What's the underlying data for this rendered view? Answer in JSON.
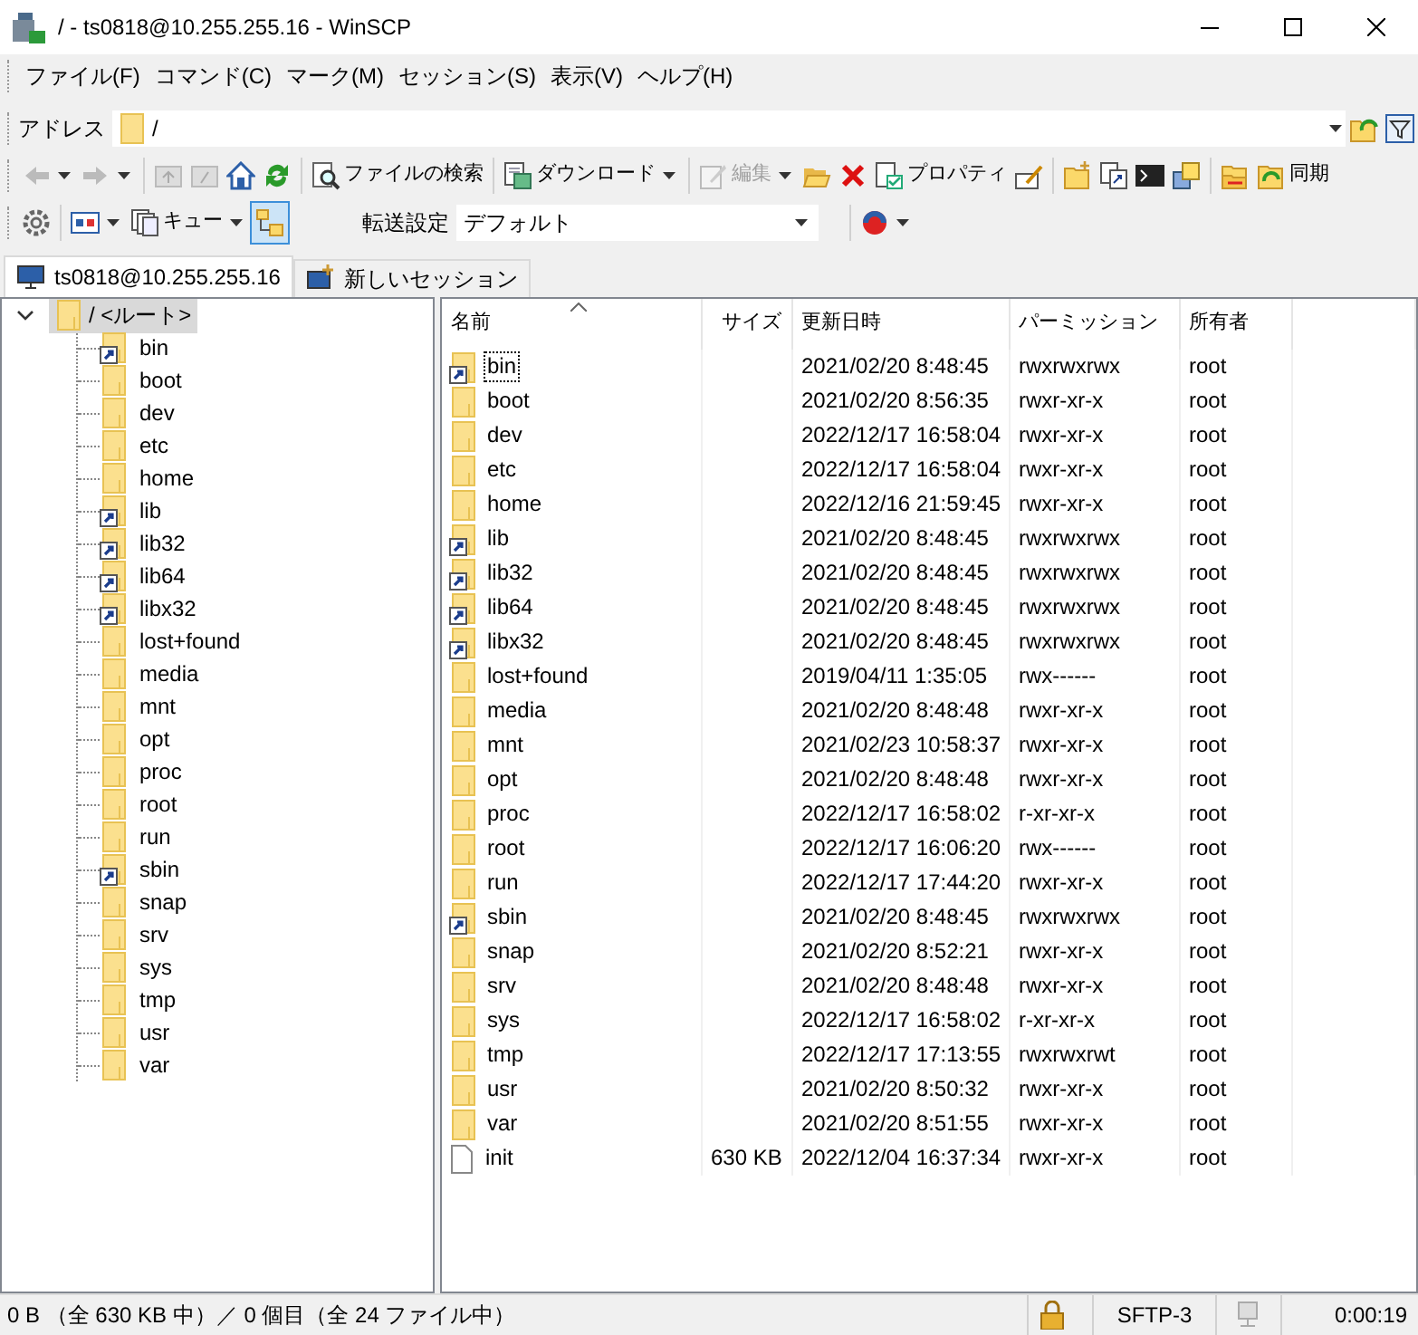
{
  "window": {
    "title": "/ - ts0818@10.255.255.16 - WinSCP"
  },
  "menu": [
    "ファイル(F)",
    "コマンド(C)",
    "マーク(M)",
    "セッション(S)",
    "表示(V)",
    "ヘルプ(H)"
  ],
  "address": {
    "label": "アドレス",
    "value": "/"
  },
  "toolbar": [
    {
      "label": "ファイルの検索",
      "disabled": false
    },
    {
      "label": "ダウンロード",
      "disabled": false
    },
    {
      "label": "編集",
      "disabled": true
    },
    {
      "label": "プロパティ",
      "disabled": false
    },
    {
      "label": "同期",
      "disabled": false
    }
  ],
  "toolbar2": {
    "queue": "キュー",
    "transfer_label": "転送設定",
    "transfer_value": "デフォルト"
  },
  "tabs": [
    {
      "label": "ts0818@10.255.255.16",
      "selected": true
    },
    {
      "label": "新しいセッション",
      "selected": false
    }
  ],
  "tree": {
    "label": "/ <ルート>",
    "selected": true,
    "expanded": true,
    "children": [
      {
        "label": "bin",
        "kind": "link"
      },
      {
        "label": "boot",
        "kind": "folder"
      },
      {
        "label": "dev",
        "kind": "folder"
      },
      {
        "label": "etc",
        "kind": "folder"
      },
      {
        "label": "home",
        "kind": "folder"
      },
      {
        "label": "lib",
        "kind": "link"
      },
      {
        "label": "lib32",
        "kind": "link"
      },
      {
        "label": "lib64",
        "kind": "link"
      },
      {
        "label": "libx32",
        "kind": "link"
      },
      {
        "label": "lost+found",
        "kind": "folder"
      },
      {
        "label": "media",
        "kind": "folder"
      },
      {
        "label": "mnt",
        "kind": "folder"
      },
      {
        "label": "opt",
        "kind": "folder"
      },
      {
        "label": "proc",
        "kind": "folder"
      },
      {
        "label": "root",
        "kind": "folder"
      },
      {
        "label": "run",
        "kind": "folder"
      },
      {
        "label": "sbin",
        "kind": "link"
      },
      {
        "label": "snap",
        "kind": "folder"
      },
      {
        "label": "srv",
        "kind": "folder"
      },
      {
        "label": "sys",
        "kind": "folder"
      },
      {
        "label": "tmp",
        "kind": "folder"
      },
      {
        "label": "usr",
        "kind": "folder"
      },
      {
        "label": "var",
        "kind": "folder"
      }
    ]
  },
  "files": {
    "columns": [
      "名前",
      "サイズ",
      "更新日時",
      "パーミッション",
      "所有者"
    ],
    "rows": [
      {
        "name": "bin",
        "kind": "link",
        "focused": true,
        "modified": "2021/02/20 8:48:45",
        "permissions": "rwxrwxrwx",
        "owner": "root"
      },
      {
        "name": "boot",
        "kind": "folder",
        "focused": false,
        "modified": "2021/02/20 8:56:35",
        "permissions": "rwxr-xr-x",
        "owner": "root"
      },
      {
        "name": "dev",
        "kind": "folder",
        "focused": false,
        "modified": "2022/12/17 16:58:04",
        "permissions": "rwxr-xr-x",
        "owner": "root"
      },
      {
        "name": "etc",
        "kind": "folder",
        "focused": false,
        "modified": "2022/12/17 16:58:04",
        "permissions": "rwxr-xr-x",
        "owner": "root"
      },
      {
        "name": "home",
        "kind": "folder",
        "focused": false,
        "modified": "2022/12/16 21:59:45",
        "permissions": "rwxr-xr-x",
        "owner": "root"
      },
      {
        "name": "lib",
        "kind": "link",
        "focused": false,
        "modified": "2021/02/20 8:48:45",
        "permissions": "rwxrwxrwx",
        "owner": "root"
      },
      {
        "name": "lib32",
        "kind": "link",
        "focused": false,
        "modified": "2021/02/20 8:48:45",
        "permissions": "rwxrwxrwx",
        "owner": "root"
      },
      {
        "name": "lib64",
        "kind": "link",
        "focused": false,
        "modified": "2021/02/20 8:48:45",
        "permissions": "rwxrwxrwx",
        "owner": "root"
      },
      {
        "name": "libx32",
        "kind": "link",
        "focused": false,
        "modified": "2021/02/20 8:48:45",
        "permissions": "rwxrwxrwx",
        "owner": "root"
      },
      {
        "name": "lost+found",
        "kind": "folder",
        "focused": false,
        "modified": "2019/04/11 1:35:05",
        "permissions": "rwx------",
        "owner": "root"
      },
      {
        "name": "media",
        "kind": "folder",
        "focused": false,
        "modified": "2021/02/20 8:48:48",
        "permissions": "rwxr-xr-x",
        "owner": "root"
      },
      {
        "name": "mnt",
        "kind": "folder",
        "focused": false,
        "modified": "2021/02/23 10:58:37",
        "permissions": "rwxr-xr-x",
        "owner": "root"
      },
      {
        "name": "opt",
        "kind": "folder",
        "focused": false,
        "modified": "2021/02/20 8:48:48",
        "permissions": "rwxr-xr-x",
        "owner": "root"
      },
      {
        "name": "proc",
        "kind": "folder",
        "focused": false,
        "modified": "2022/12/17 16:58:02",
        "permissions": "r-xr-xr-x",
        "owner": "root"
      },
      {
        "name": "root",
        "kind": "folder",
        "focused": false,
        "modified": "2022/12/17 16:06:20",
        "permissions": "rwx------",
        "owner": "root"
      },
      {
        "name": "run",
        "kind": "folder",
        "focused": false,
        "modified": "2022/12/17 17:44:20",
        "permissions": "rwxr-xr-x",
        "owner": "root"
      },
      {
        "name": "sbin",
        "kind": "link",
        "focused": false,
        "modified": "2021/02/20 8:48:45",
        "permissions": "rwxrwxrwx",
        "owner": "root"
      },
      {
        "name": "snap",
        "kind": "folder",
        "focused": false,
        "modified": "2021/02/20 8:52:21",
        "permissions": "rwxr-xr-x",
        "owner": "root"
      },
      {
        "name": "srv",
        "kind": "folder",
        "focused": false,
        "modified": "2021/02/20 8:48:48",
        "permissions": "rwxr-xr-x",
        "owner": "root"
      },
      {
        "name": "sys",
        "kind": "folder",
        "focused": false,
        "modified": "2022/12/17 16:58:02",
        "permissions": "r-xr-xr-x",
        "owner": "root"
      },
      {
        "name": "tmp",
        "kind": "folder",
        "focused": false,
        "modified": "2022/12/17 17:13:55",
        "permissions": "rwxrwxrwt",
        "owner": "root"
      },
      {
        "name": "usr",
        "kind": "folder",
        "focused": false,
        "modified": "2021/02/20 8:50:32",
        "permissions": "rwxr-xr-x",
        "owner": "root"
      },
      {
        "name": "var",
        "kind": "folder",
        "focused": false,
        "modified": "2021/02/20 8:51:55",
        "permissions": "rwxr-xr-x",
        "owner": "root"
      },
      {
        "name": "init",
        "kind": "file",
        "focused": false,
        "size": "630 KB",
        "modified": "2022/12/04 16:37:34",
        "permissions": "rwxr-xr-x",
        "owner": "root"
      }
    ]
  },
  "status_bar": {
    "summary": "0 B （全 630 KB 中）／ 0 個目（全 24 ファイル中）",
    "protocol": "SFTP-3",
    "elapsed": "0:00:19"
  }
}
